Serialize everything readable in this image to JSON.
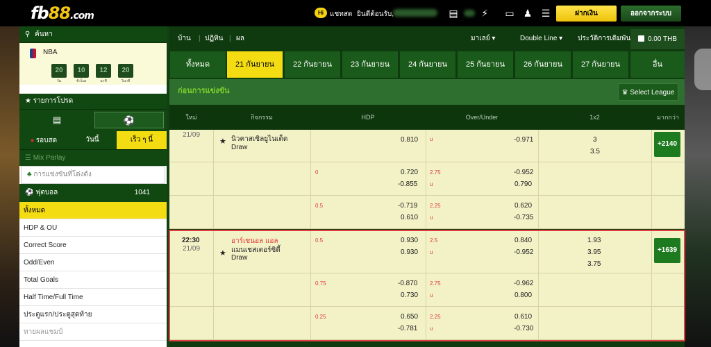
{
  "header": {
    "logo_prefix": "fb",
    "logo_num": "88",
    "logo_domain": ".com",
    "chat_badge": "Hi",
    "chat_label": "แชทสด",
    "welcome": "ยินดีต้อนรับ,",
    "deposit": "ฝากเงิน",
    "logout": "ออกจากระบบ"
  },
  "sidebar": {
    "search": "ค้นหา",
    "league": "NBA",
    "timer": [
      {
        "value": "20",
        "caption": "วัน"
      },
      {
        "value": "10",
        "caption": "ชั่วโมง"
      },
      {
        "value": "12",
        "caption": "นาที"
      },
      {
        "value": "20",
        "caption": "วินาที"
      }
    ],
    "favorites": "รายการโปรด",
    "tabs": [
      "รอบสด",
      "วันนี้",
      "เร็ว ๆ นี้"
    ],
    "mix_parlay": "Mix Parlay",
    "search_placeholder": "การแข่งขันที่โด่งดัง",
    "sport": "ฟุตบอล",
    "sport_count": "1041",
    "items": [
      "ทั้งหมด",
      "HDP & OU",
      "Correct Score",
      "Odd/Even",
      "Total Goals",
      "Half Time/Full Time",
      "ประตูแรก/ประตูสุดท้าย",
      "ทายผลแชมป์"
    ]
  },
  "content": {
    "nav": {
      "home": "บ้าน",
      "calendar": "ปฏิทิน",
      "results": "ผล",
      "odds_format": "มาเลย์",
      "line_mode": "Double Line",
      "bet_history": "ประวัติการเดิมพัน",
      "balance": "0.00 THB"
    },
    "date_tabs": [
      "ทั้งหมด",
      "21 กันยายน",
      "22 กันยายน",
      "23 กันยายน",
      "24 กันยายน",
      "25 กันยายน",
      "26 กันยายน",
      "27 กันยายน",
      "อื่น"
    ],
    "prematch_label": "ก่อนการแข่งขัน",
    "select_league": "Select League",
    "columns": {
      "time": "ใหม่",
      "event": "กิจกรรม",
      "hdp": "HDP",
      "ou": "Over/Under",
      "x12": "1x2",
      "more": "มากกว่า"
    },
    "matches": [
      {
        "date": "21/09",
        "home": "นิวคาสเซิลยูไนเต็ด",
        "draw": "Draw",
        "more": "+2140",
        "lines": [
          {
            "hdp_line": "",
            "hdp_top": "0.810",
            "hdp_bot": "",
            "ou_line": "u",
            "ou_top": "-0.971",
            "ou_bot": "",
            "x_top": "3",
            "x_bot": "3.5"
          },
          {
            "hdp_line": "0",
            "hdp_top": "0.720",
            "hdp_bot": "-0.855",
            "ou_line": "2.75",
            "ou_top": "-0.952",
            "ou_bot": "0.790",
            "x_top": "",
            "x_bot": ""
          },
          {
            "hdp_line": "0.5",
            "hdp_top": "-0.719",
            "hdp_bot": "0.610",
            "ou_line": "2.25",
            "ou_top": "0.620",
            "ou_bot": "-0.735",
            "x_top": "",
            "x_bot": ""
          }
        ]
      },
      {
        "time": "22:30",
        "date": "21/09",
        "home": "อาร์เซนอล แอล",
        "away": "แมนเชสเตอร์ซิตี้",
        "draw": "Draw",
        "more": "+1639",
        "lines": [
          {
            "hdp_line": "0.5",
            "hdp_top": "0.930",
            "hdp_bot": "0.930",
            "ou_line": "2.5",
            "ou_top": "0.840",
            "ou_bot": "-0.952",
            "x_top": "1.93",
            "x_mid": "3.95",
            "x_bot": "3.75"
          },
          {
            "hdp_line": "0.75",
            "hdp_top": "-0.870",
            "hdp_bot": "0.730",
            "ou_line": "2.75",
            "ou_top": "-0.962",
            "ou_bot": "0.800",
            "x_top": "",
            "x_bot": ""
          },
          {
            "hdp_line": "0.25",
            "hdp_top": "0.650",
            "hdp_bot": "-0.781",
            "ou_line": "2.25",
            "ou_top": "0.610",
            "ou_bot": "-0.730",
            "x_top": "",
            "x_bot": ""
          }
        ]
      }
    ]
  },
  "colors": {
    "accent": "#f4dc12",
    "dark_green": "#114811",
    "row_bg": "#f3f2c7",
    "highlight": "#e03f3f"
  }
}
